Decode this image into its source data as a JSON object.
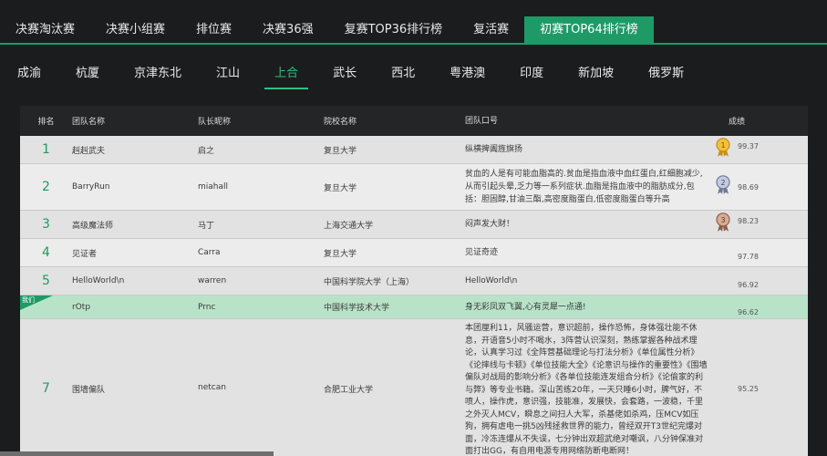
{
  "top_tabs": [
    "决赛淘汰赛",
    "决赛小组赛",
    "排位赛",
    "决赛36强",
    "复赛TOP36排行榜",
    "复活赛",
    "初赛TOP64排行榜"
  ],
  "top_active": 6,
  "region_tabs": [
    "成渝",
    "杭厦",
    "京津东北",
    "江山",
    "上合",
    "武长",
    "西北",
    "粤港澳",
    "印度",
    "新加坡",
    "俄罗斯"
  ],
  "region_active": 4,
  "table": {
    "headers": {
      "rank": "排名",
      "team": "团队名称",
      "captain": "队长昵称",
      "school": "院校名称",
      "slogan": "团队口号",
      "score": "成绩"
    },
    "ours_label": "我们",
    "rows": [
      {
        "rank": "1",
        "team": "赳赳武夫",
        "captain": "启之",
        "school": "复旦大学",
        "slogan": "纵横捭阖旌旗扬",
        "score": "99.37",
        "medal": "1",
        "medal_color": "#d9a21b"
      },
      {
        "rank": "2",
        "team": "BarryRun",
        "captain": "miahall",
        "school": "复旦大学",
        "slogan": "贫血的人是有可能血脂高的.贫血是指血液中血红蛋白,红细胞减少,从而引起头晕,乏力等一系列症状.血脂是指血液中的脂肪成分,包括：胆固醇,甘油三酯,高密度脂蛋白,低密度脂蛋白等升高",
        "score": "98.69",
        "medal": "2",
        "medal_color": "#8f9bb8"
      },
      {
        "rank": "3",
        "team": "高级魔法师",
        "captain": "马丁",
        "school": "上海交通大学",
        "slogan": "闷声发大财！",
        "score": "98.23",
        "medal": "3",
        "medal_color": "#b7846a"
      },
      {
        "rank": "4",
        "team": "见证者",
        "captain": "Carra",
        "school": "复旦大学",
        "slogan": "见证奇迹",
        "score": "97.78",
        "medal": ""
      },
      {
        "rank": "5",
        "team": "HelloWorld\\n",
        "captain": "warren",
        "school": "中国科学院大学（上海）",
        "slogan": "HelloWorld\\n",
        "score": "96.92",
        "medal": ""
      },
      {
        "rank": "",
        "team": "rOtp",
        "captain": "Prnc",
        "school": "中国科学技术大学",
        "slogan": "身无彩凤双飞翼,心有灵犀一点通!",
        "score": "96.62",
        "medal": "",
        "ours": true
      },
      {
        "rank": "7",
        "team": "围墙偏队",
        "captain": "netcan",
        "school": "合肥工业大学",
        "slogan": "本团厘利11，风骚运营，意识超前，操作恐怖，身体强壮能不休息，开语音5小时不喝水，3阵营认识深刻，熟练掌握各种战术理论，认真学习过《全阵营基础理论与打法分析》《单位属性分析》《论摔线与卡顿》《单位技能大全》《论意识与操作的重要性》《围墙偏队对战局的影响分析》《各单位技能连发组合分析》《论偷家的利与弊》等专业书籍。深山苦练20年，一天只睡6小时，脾气好，不喷人，操作虎，意识强，技能准，发展快，会套路，一波稳，千里之外灭人MCV，瞬息之间扫人大军，杀基佬如杀鸡，压MCV如压狗，拥有虐电一挑5凶残拯救世界的能力，曾经双开T3世纪完爆对面，冷冻连爆从不失误，七分钟出双超武绝对嘲讽，八分钟保准对面打出GG，有自用电源专用网络防断电断网！",
        "score": "95.25",
        "medal": ""
      }
    ]
  },
  "colors": {
    "accent": "#1e9a67",
    "rank_green": "#1f9b60",
    "ours_bg": "#b9e3c9"
  }
}
